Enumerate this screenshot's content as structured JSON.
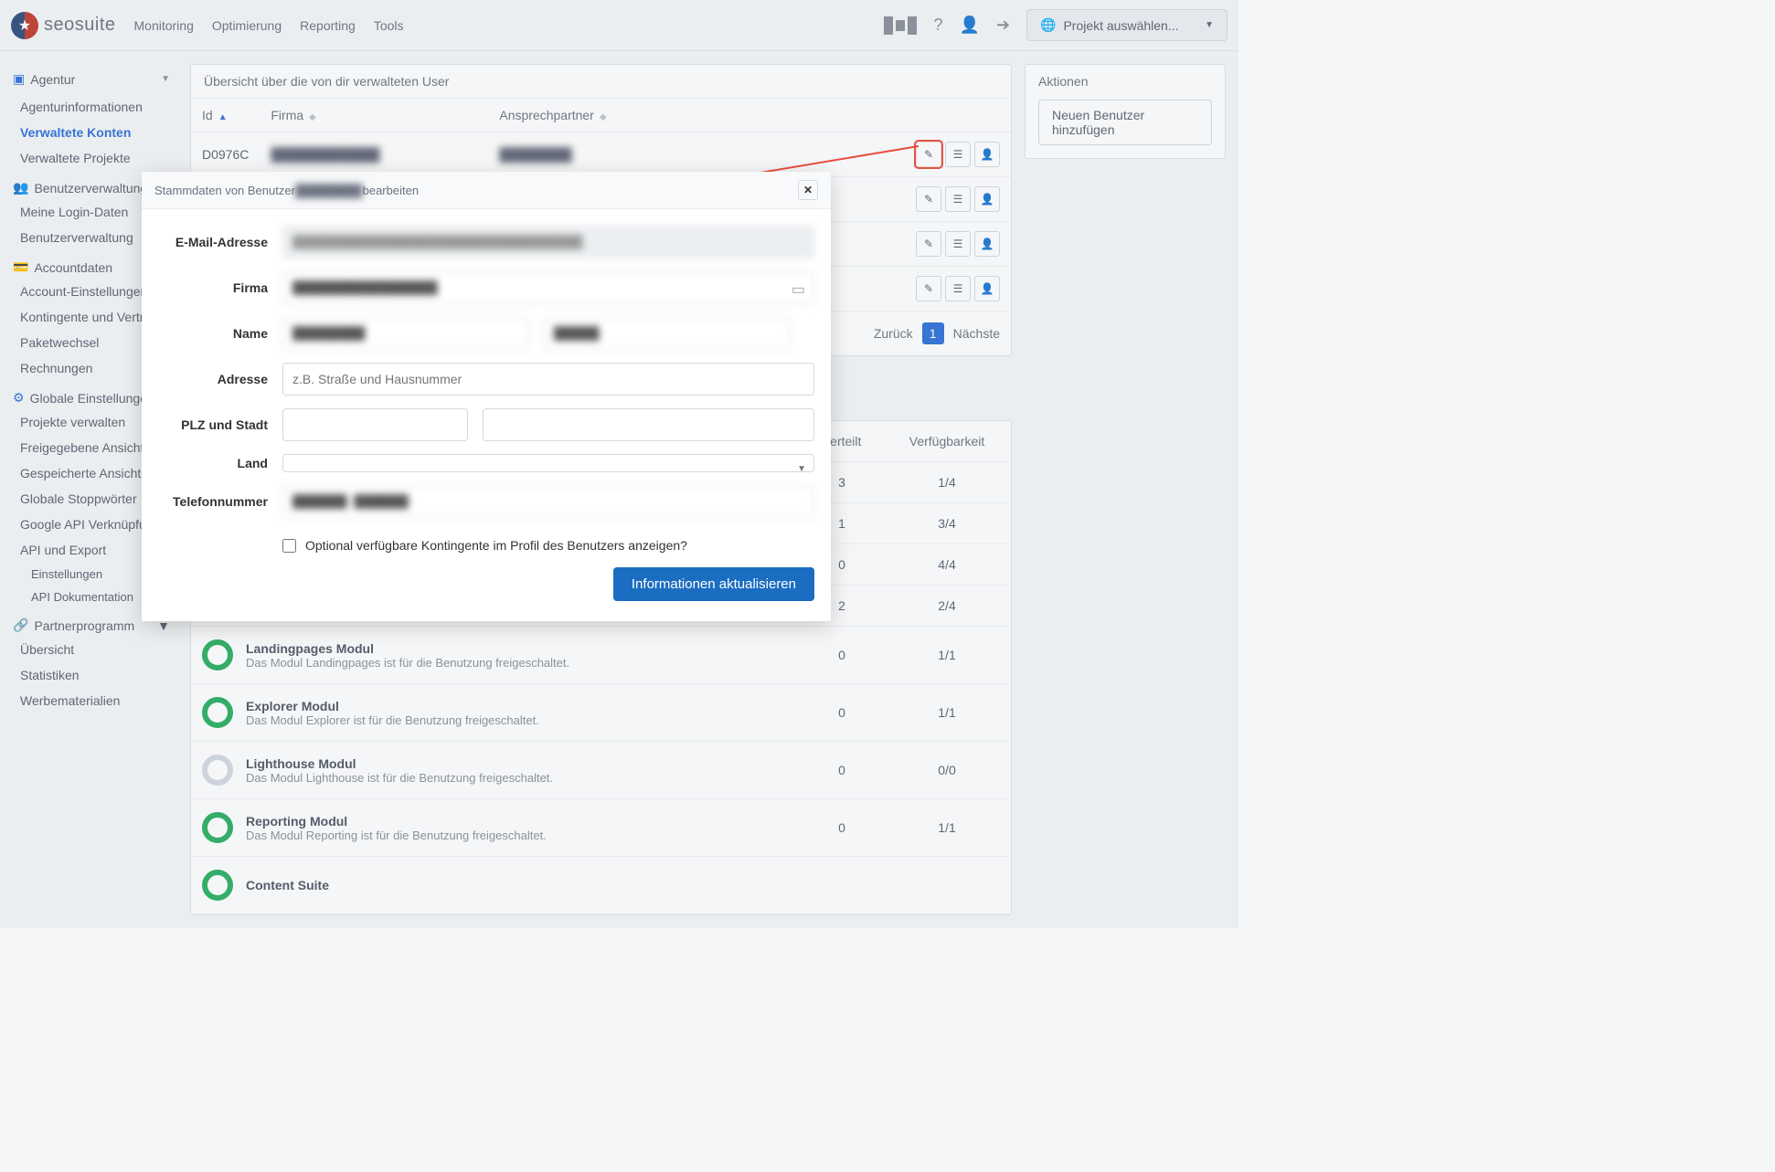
{
  "navbar": {
    "brand": "seosuite",
    "menu": [
      "Monitoring",
      "Optimierung",
      "Reporting",
      "Tools"
    ],
    "project_select": "Projekt auswählen..."
  },
  "sidebar": {
    "agentur_title": "Agentur",
    "agentur_items": [
      "Agenturinformationen",
      "Verwaltete Konten",
      "Verwaltete Projekte"
    ],
    "agentur_active_index": 1,
    "benutzer_title": "Benutzerverwaltung",
    "benutzer_items": [
      "Meine Login-Daten",
      "Benutzerverwaltung"
    ],
    "account_title": "Accountdaten",
    "account_items": [
      "Account-Einstellungen",
      "Kontingente und Verträge",
      "Paketwechsel",
      "Rechnungen"
    ],
    "global_title": "Globale Einstellungen",
    "global_items": [
      "Projekte verwalten",
      "Freigegebene Ansichten",
      "Gespeicherte Ansichten",
      "Globale Stoppwörter",
      "Google API Verknüpfung",
      "API und Export"
    ],
    "global_sub": [
      "Einstellungen",
      "API Dokumentation"
    ],
    "partner_title": "Partnerprogramm",
    "partner_items": [
      "Übersicht",
      "Statistiken",
      "Werbematerialien"
    ]
  },
  "actions": {
    "panel_title": "Aktionen",
    "new_user": "Neuen Benutzer hinzufügen"
  },
  "users_panel": {
    "title": "Übersicht über die von dir verwalteten User",
    "cols": {
      "id": "Id",
      "firma": "Firma",
      "ansprechpartner": "Ansprechpartner",
      "actions": ""
    },
    "rows": [
      {
        "id": "D0976C",
        "firma": "████████████",
        "ansprechpartner": "████████"
      }
    ],
    "pagination": {
      "prev": "Zurück",
      "page": "1",
      "next": "Nächste"
    }
  },
  "modules": {
    "cols": {
      "verteilt": "Verteilt",
      "verfuegbarkeit": "Verfügbarkeit"
    },
    "rows": [
      {
        "verteilt": "3",
        "verf": "1/4"
      },
      {
        "verteilt": "1",
        "verf": "3/4"
      },
      {
        "verteilt": "0",
        "verf": "4/4"
      },
      {
        "verteilt": "2",
        "verf": "2/4"
      },
      {
        "title": "Landingpages Modul",
        "desc": "Das Modul Landingpages ist für die Benutzung freigeschaltet.",
        "verteilt": "0",
        "verf": "1/1",
        "color": "green"
      },
      {
        "title": "Explorer Modul",
        "desc": "Das Modul Explorer ist für die Benutzung freigeschaltet.",
        "verteilt": "0",
        "verf": "1/1",
        "color": "green"
      },
      {
        "title": "Lighthouse Modul",
        "desc": "Das Modul Lighthouse ist für die Benutzung freigeschaltet.",
        "verteilt": "0",
        "verf": "0/0",
        "color": "grey"
      },
      {
        "title": "Reporting Modul",
        "desc": "Das Modul Reporting ist für die Benutzung freigeschaltet.",
        "verteilt": "0",
        "verf": "1/1",
        "color": "green"
      },
      {
        "title": "Content Suite",
        "desc": "",
        "verteilt": "",
        "verf": "",
        "color": "green"
      }
    ]
  },
  "modal": {
    "title_prefix": "Stammdaten von Benutzer ",
    "title_user": "████████",
    "title_suffix": " bearbeiten",
    "labels": {
      "email": "E-Mail-Adresse",
      "firma": "Firma",
      "name": "Name",
      "adresse": "Adresse",
      "plz": "PLZ und Stadt",
      "land": "Land",
      "phone": "Telefonnummer"
    },
    "values": {
      "email": "████████████████████████████████",
      "firma": "████████████████",
      "firstname": "████████",
      "lastname": "█████",
      "adresse": "",
      "plz": "",
      "city": "",
      "land": "",
      "phone": "██████  ██████"
    },
    "placeholders": {
      "adresse": "z.B. Straße und Hausnummer"
    },
    "checkbox": "Optional verfügbare Kontingente im Profil des Benutzers anzeigen?",
    "submit": "Informationen aktualisieren"
  }
}
